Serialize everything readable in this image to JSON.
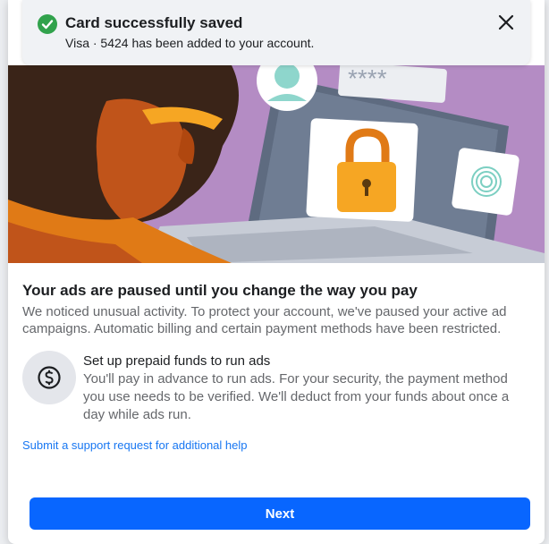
{
  "toast": {
    "title": "Card successfully saved",
    "message": "Visa · 5424 has been added to your account."
  },
  "hero": {
    "masked_field": "****"
  },
  "main": {
    "title": "Your ads are paused until you change the way you pay",
    "description": "We noticed unusual activity. To protect your account, we've paused your active ad campaigns. Automatic billing and certain payment methods have been restricted."
  },
  "option": {
    "icon": "dollar-circle-icon",
    "title": "Set up prepaid funds to run ads",
    "description": "You'll pay in advance to run ads. For your security, the payment method you use needs to be verified. We'll deduct from your funds about once a day while ads run."
  },
  "support_link": "Submit a support request for additional help",
  "next_button": "Next",
  "colors": {
    "primary": "#0866ff",
    "link": "#1877f2",
    "success": "#31a24c",
    "hero_purple": "#b48cc4"
  }
}
